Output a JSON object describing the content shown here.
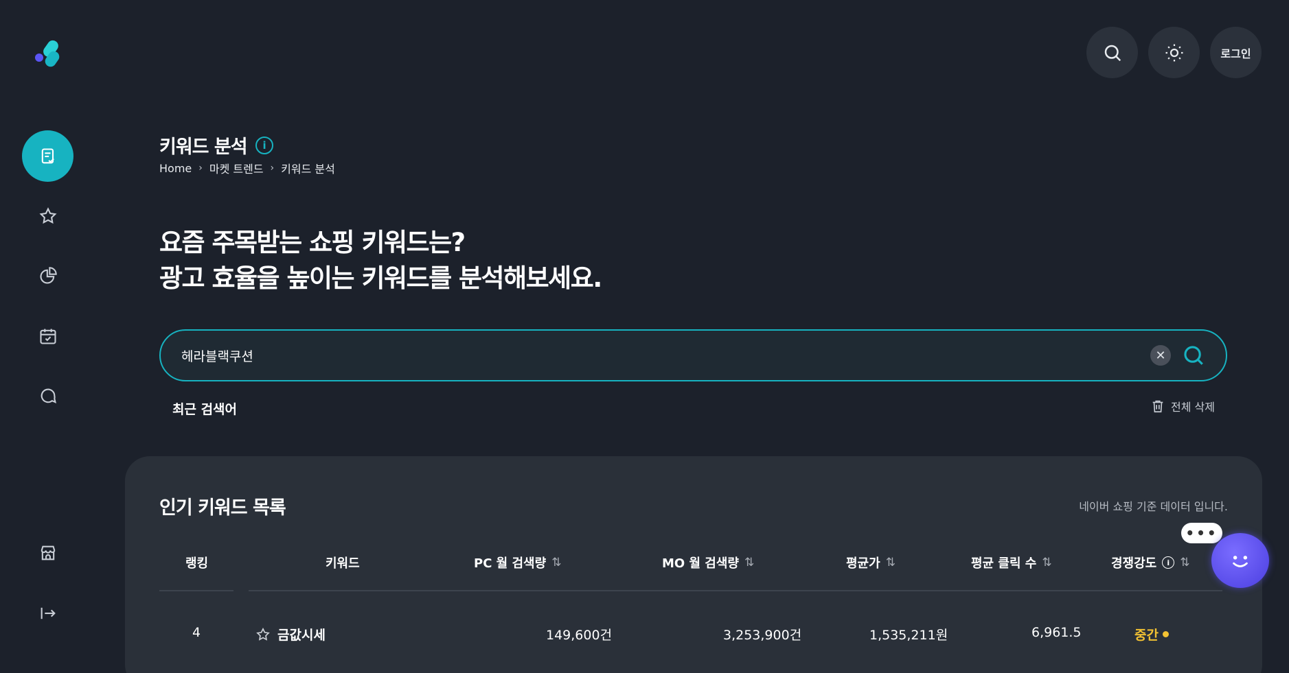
{
  "top_actions": {
    "login_label": "로그인"
  },
  "header": {
    "title": "키워드 분석",
    "info_glyph": "i",
    "breadcrumb": [
      "Home",
      "마켓 트렌드",
      "키워드 분석"
    ],
    "breadcrumb_sep": "›"
  },
  "headline": {
    "line1": "요즘 주목받는 쇼핑 키워드는?",
    "line2": "광고 효율을 높이는 키워드를 분석해보세요."
  },
  "search": {
    "value": "헤라블랙쿠션",
    "clear_glyph": "✕"
  },
  "recent": {
    "label": "최근 검색어",
    "delete_all_label": "전체 삭제"
  },
  "popular": {
    "title": "인기 키워드 목록",
    "note": "네이버 쇼핑 기준 데이터 입니다.",
    "columns": {
      "rank": "랭킹",
      "keyword": "키워드",
      "pc": "PC 월 검색량",
      "mo": "MO 월 검색량",
      "price": "평균가",
      "clicks": "평균 클릭 수",
      "competition": "경쟁강도"
    },
    "sort_glyph": "⇅",
    "info_glyph": "i",
    "rows": [
      {
        "rank": "4",
        "keyword": "금값시세",
        "pc": "149,600건",
        "mo": "3,253,900건",
        "price": "1,535,211원",
        "clicks": "6,961.5",
        "competition": "중간"
      }
    ]
  },
  "chat": {
    "bubble": "•••"
  },
  "colors": {
    "accent": "#17b3c1",
    "background": "#1c212b",
    "panel": "#2a3039",
    "competition_medium": "#f3c233",
    "chat_bot": "#5b4ff0"
  }
}
